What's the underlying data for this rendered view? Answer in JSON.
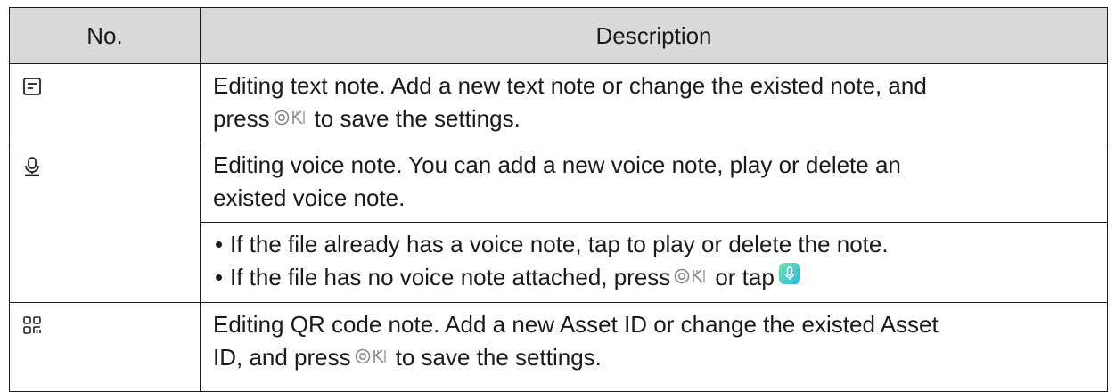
{
  "table": {
    "headers": {
      "no": "No.",
      "description": "Description"
    },
    "rows": [
      {
        "icon": "text-note-icon",
        "lines": [
          "Editing text note. Add a new text note or change the existed note, and",
          "press",
          "to save the settings."
        ]
      },
      {
        "icon": "microphone-icon",
        "lines": [
          "Editing voice note. You can add a new voice note, play or delete an",
          "existed voice note."
        ],
        "bullets": [
          "If the file already has a voice note, tap to play or delete the note.",
          "If the file has no voice note attached, press",
          "or tap"
        ]
      },
      {
        "icon": "qr-code-icon",
        "lines": [
          "Editing QR code note. Add a new Asset ID or change the existed Asset",
          "ID, and press",
          "to save the settings."
        ]
      }
    ]
  },
  "icons": {
    "ok_button": "ok-button-icon",
    "mic_button": "microphone-button-icon"
  },
  "colors": {
    "header_bg": "#d9d9d9",
    "mic_button_gradient_start": "#6fe3a8",
    "mic_button_gradient_end": "#2fb8e6"
  }
}
